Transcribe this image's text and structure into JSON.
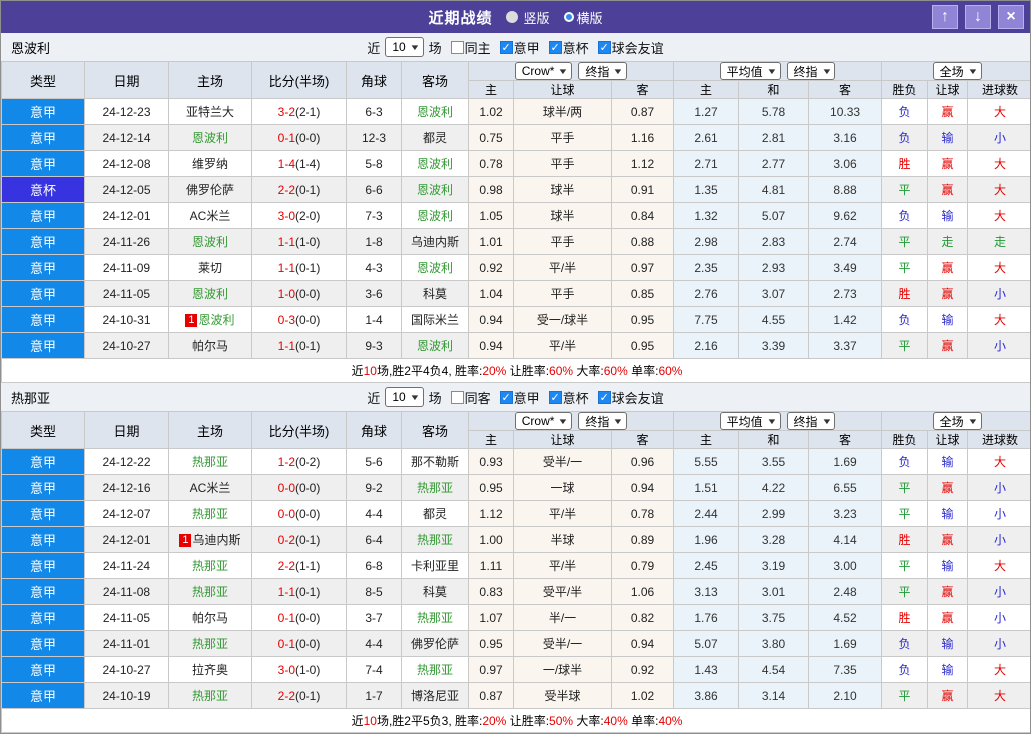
{
  "window": {
    "title": "近期战绩",
    "radio_options": [
      {
        "label": "竖版",
        "selected": false
      },
      {
        "label": "横版",
        "selected": true
      }
    ],
    "buttons": {
      "up_icon": "↑",
      "down_icon": "↓",
      "close_icon": "×"
    }
  },
  "colors": {
    "league": {
      "意甲": "#1289e8",
      "意杯": "#3733e0"
    },
    "result": {
      "胜": "#e60000",
      "负": "#2929cc",
      "平": "#1f9a35",
      "赢": "#e60000",
      "输": "#2929cc",
      "走": "#1f9a35",
      "大": "#e60000",
      "小": "#2929cc"
    },
    "team_active": "#339933"
  },
  "columns": {
    "left": [
      "类型",
      "日期",
      "主场",
      "比分(半场)",
      "角球",
      "客场"
    ],
    "odds_sub": [
      "主",
      "让球",
      "客"
    ],
    "avg_sub": [
      "主",
      "和",
      "客"
    ],
    "result_sub": [
      "胜负",
      "让球",
      "进球数"
    ],
    "selects": {
      "odds_company": "Crow*",
      "odds_terminal": "终指",
      "average": "平均值",
      "average_terminal": "终指",
      "scope": "全场"
    }
  },
  "sections": [
    {
      "team": "恩波利",
      "filter": {
        "prefix": "近",
        "count": "10",
        "suffix": "场",
        "same_label": "同主",
        "same_checked": false,
        "leagues": [
          {
            "label": "意甲",
            "checked": true
          },
          {
            "label": "意杯",
            "checked": true
          },
          {
            "label": "球会友谊",
            "checked": true
          }
        ]
      },
      "rows": [
        {
          "league": "意甲",
          "date": "24-12-23",
          "home": "亚特兰大",
          "home_badge": "",
          "score": "3-2",
          "half": "(2-1)",
          "corner": "6-3",
          "away": "恩波利",
          "away_badge": "",
          "odds": [
            "1.02",
            "球半/两",
            "0.87"
          ],
          "avg": [
            "1.27",
            "5.78",
            "10.33"
          ],
          "results": [
            "负",
            "赢",
            "大"
          ]
        },
        {
          "league": "意甲",
          "date": "24-12-14",
          "home": "恩波利",
          "home_badge": "",
          "score": "0-1",
          "half": "(0-0)",
          "corner": "12-3",
          "away": "都灵",
          "away_badge": "",
          "odds": [
            "0.75",
            "平手",
            "1.16"
          ],
          "avg": [
            "2.61",
            "2.81",
            "3.16"
          ],
          "results": [
            "负",
            "输",
            "小"
          ]
        },
        {
          "league": "意甲",
          "date": "24-12-08",
          "home": "维罗纳",
          "home_badge": "",
          "score": "1-4",
          "half": "(1-4)",
          "corner": "5-8",
          "away": "恩波利",
          "away_badge": "",
          "odds": [
            "0.78",
            "平手",
            "1.12"
          ],
          "avg": [
            "2.71",
            "2.77",
            "3.06"
          ],
          "results": [
            "胜",
            "赢",
            "大"
          ]
        },
        {
          "league": "意杯",
          "date": "24-12-05",
          "home": "佛罗伦萨",
          "home_badge": "",
          "score": "2-2",
          "half": "(0-1)",
          "corner": "6-6",
          "away": "恩波利",
          "away_badge": "",
          "odds": [
            "0.98",
            "球半",
            "0.91"
          ],
          "avg": [
            "1.35",
            "4.81",
            "8.88"
          ],
          "results": [
            "平",
            "赢",
            "大"
          ]
        },
        {
          "league": "意甲",
          "date": "24-12-01",
          "home": "AC米兰",
          "home_badge": "",
          "score": "3-0",
          "half": "(2-0)",
          "corner": "7-3",
          "away": "恩波利",
          "away_badge": "",
          "odds": [
            "1.05",
            "球半",
            "0.84"
          ],
          "avg": [
            "1.32",
            "5.07",
            "9.62"
          ],
          "results": [
            "负",
            "输",
            "大"
          ]
        },
        {
          "league": "意甲",
          "date": "24-11-26",
          "home": "恩波利",
          "home_badge": "",
          "score": "1-1",
          "half": "(1-0)",
          "corner": "1-8",
          "away": "乌迪内斯",
          "away_badge": "",
          "odds": [
            "1.01",
            "平手",
            "0.88"
          ],
          "avg": [
            "2.98",
            "2.83",
            "2.74"
          ],
          "results": [
            "平",
            "走",
            "走"
          ]
        },
        {
          "league": "意甲",
          "date": "24-11-09",
          "home": "莱切",
          "home_badge": "",
          "score": "1-1",
          "half": "(0-1)",
          "corner": "4-3",
          "away": "恩波利",
          "away_badge": "",
          "odds": [
            "0.92",
            "平/半",
            "0.97"
          ],
          "avg": [
            "2.35",
            "2.93",
            "3.49"
          ],
          "results": [
            "平",
            "赢",
            "大"
          ]
        },
        {
          "league": "意甲",
          "date": "24-11-05",
          "home": "恩波利",
          "home_badge": "",
          "score": "1-0",
          "half": "(0-0)",
          "corner": "3-6",
          "away": "科莫",
          "away_badge": "",
          "odds": [
            "1.04",
            "平手",
            "0.85"
          ],
          "avg": [
            "2.76",
            "3.07",
            "2.73"
          ],
          "results": [
            "胜",
            "赢",
            "小"
          ]
        },
        {
          "league": "意甲",
          "date": "24-10-31",
          "home": "恩波利",
          "home_badge": "1",
          "score": "0-3",
          "half": "(0-0)",
          "corner": "1-4",
          "away": "国际米兰",
          "away_badge": "",
          "odds": [
            "0.94",
            "受一/球半",
            "0.95"
          ],
          "avg": [
            "7.75",
            "4.55",
            "1.42"
          ],
          "results": [
            "负",
            "输",
            "大"
          ]
        },
        {
          "league": "意甲",
          "date": "24-10-27",
          "home": "帕尔马",
          "home_badge": "",
          "score": "1-1",
          "half": "(0-1)",
          "corner": "9-3",
          "away": "恩波利",
          "away_badge": "",
          "odds": [
            "0.94",
            "平/半",
            "0.95"
          ],
          "avg": [
            "2.16",
            "3.39",
            "3.37"
          ],
          "results": [
            "平",
            "赢",
            "小"
          ]
        }
      ],
      "summary": [
        {
          "text": "近",
          "red": false
        },
        {
          "text": "10",
          "red": true
        },
        {
          "text": "场,胜2平4负4, 胜率:",
          "red": false
        },
        {
          "text": "20%",
          "red": true
        },
        {
          "text": " 让胜率:",
          "red": false
        },
        {
          "text": "60%",
          "red": true
        },
        {
          "text": " 大率:",
          "red": false
        },
        {
          "text": "60%",
          "red": true
        },
        {
          "text": " 单率:",
          "red": false
        },
        {
          "text": "60%",
          "red": true
        }
      ]
    },
    {
      "team": "热那亚",
      "filter": {
        "prefix": "近",
        "count": "10",
        "suffix": "场",
        "same_label": "同客",
        "same_checked": false,
        "leagues": [
          {
            "label": "意甲",
            "checked": true
          },
          {
            "label": "意杯",
            "checked": true
          },
          {
            "label": "球会友谊",
            "checked": true
          }
        ]
      },
      "rows": [
        {
          "league": "意甲",
          "date": "24-12-22",
          "home": "热那亚",
          "home_badge": "",
          "score": "1-2",
          "half": "(0-2)",
          "corner": "5-6",
          "away": "那不勒斯",
          "away_badge": "",
          "odds": [
            "0.93",
            "受半/一",
            "0.96"
          ],
          "avg": [
            "5.55",
            "3.55",
            "1.69"
          ],
          "results": [
            "负",
            "输",
            "大"
          ]
        },
        {
          "league": "意甲",
          "date": "24-12-16",
          "home": "AC米兰",
          "home_badge": "",
          "score": "0-0",
          "half": "(0-0)",
          "corner": "9-2",
          "away": "热那亚",
          "away_badge": "",
          "odds": [
            "0.95",
            "一球",
            "0.94"
          ],
          "avg": [
            "1.51",
            "4.22",
            "6.55"
          ],
          "results": [
            "平",
            "赢",
            "小"
          ]
        },
        {
          "league": "意甲",
          "date": "24-12-07",
          "home": "热那亚",
          "home_badge": "",
          "score": "0-0",
          "half": "(0-0)",
          "corner": "4-4",
          "away": "都灵",
          "away_badge": "",
          "odds": [
            "1.12",
            "平/半",
            "0.78"
          ],
          "avg": [
            "2.44",
            "2.99",
            "3.23"
          ],
          "results": [
            "平",
            "输",
            "小"
          ]
        },
        {
          "league": "意甲",
          "date": "24-12-01",
          "home": "乌迪内斯",
          "home_badge": "1",
          "score": "0-2",
          "half": "(0-1)",
          "corner": "6-4",
          "away": "热那亚",
          "away_badge": "",
          "odds": [
            "1.00",
            "半球",
            "0.89"
          ],
          "avg": [
            "1.96",
            "3.28",
            "4.14"
          ],
          "results": [
            "胜",
            "赢",
            "小"
          ]
        },
        {
          "league": "意甲",
          "date": "24-11-24",
          "home": "热那亚",
          "home_badge": "",
          "score": "2-2",
          "half": "(1-1)",
          "corner": "6-8",
          "away": "卡利亚里",
          "away_badge": "",
          "odds": [
            "1.11",
            "平/半",
            "0.79"
          ],
          "avg": [
            "2.45",
            "3.19",
            "3.00"
          ],
          "results": [
            "平",
            "输",
            "大"
          ]
        },
        {
          "league": "意甲",
          "date": "24-11-08",
          "home": "热那亚",
          "home_badge": "",
          "score": "1-1",
          "half": "(0-1)",
          "corner": "8-5",
          "away": "科莫",
          "away_badge": "",
          "odds": [
            "0.83",
            "受平/半",
            "1.06"
          ],
          "avg": [
            "3.13",
            "3.01",
            "2.48"
          ],
          "results": [
            "平",
            "赢",
            "小"
          ]
        },
        {
          "league": "意甲",
          "date": "24-11-05",
          "home": "帕尔马",
          "home_badge": "",
          "score": "0-1",
          "half": "(0-0)",
          "corner": "3-7",
          "away": "热那亚",
          "away_badge": "",
          "odds": [
            "1.07",
            "半/一",
            "0.82"
          ],
          "avg": [
            "1.76",
            "3.75",
            "4.52"
          ],
          "results": [
            "胜",
            "赢",
            "小"
          ]
        },
        {
          "league": "意甲",
          "date": "24-11-01",
          "home": "热那亚",
          "home_badge": "",
          "score": "0-1",
          "half": "(0-0)",
          "corner": "4-4",
          "away": "佛罗伦萨",
          "away_badge": "",
          "odds": [
            "0.95",
            "受半/一",
            "0.94"
          ],
          "avg": [
            "5.07",
            "3.80",
            "1.69"
          ],
          "results": [
            "负",
            "输",
            "小"
          ]
        },
        {
          "league": "意甲",
          "date": "24-10-27",
          "home": "拉齐奥",
          "home_badge": "",
          "score": "3-0",
          "half": "(1-0)",
          "corner": "7-4",
          "away": "热那亚",
          "away_badge": "",
          "odds": [
            "0.97",
            "一/球半",
            "0.92"
          ],
          "avg": [
            "1.43",
            "4.54",
            "7.35"
          ],
          "results": [
            "负",
            "输",
            "大"
          ]
        },
        {
          "league": "意甲",
          "date": "24-10-19",
          "home": "热那亚",
          "home_badge": "",
          "score": "2-2",
          "half": "(0-1)",
          "corner": "1-7",
          "away": "博洛尼亚",
          "away_badge": "",
          "odds": [
            "0.87",
            "受半球",
            "1.02"
          ],
          "avg": [
            "3.86",
            "3.14",
            "2.10"
          ],
          "results": [
            "平",
            "赢",
            "大"
          ]
        }
      ],
      "summary": [
        {
          "text": "近",
          "red": false
        },
        {
          "text": "10",
          "red": true
        },
        {
          "text": "场,胜2平5负3, 胜率:",
          "red": false
        },
        {
          "text": "20%",
          "red": true
        },
        {
          "text": " 让胜率:",
          "red": false
        },
        {
          "text": "50%",
          "red": true
        },
        {
          "text": " 大率:",
          "red": false
        },
        {
          "text": "40%",
          "red": true
        },
        {
          "text": " 单率:",
          "red": false
        },
        {
          "text": "40%",
          "red": true
        }
      ]
    }
  ]
}
